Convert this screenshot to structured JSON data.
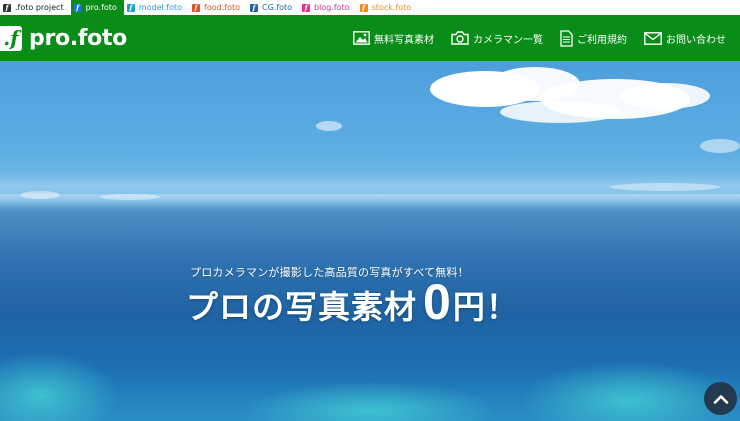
{
  "tabs": [
    {
      "label": ".foto project",
      "mark": "f",
      "color": "#222222",
      "mark_color": "#333333",
      "active": false
    },
    {
      "label": "pro.foto",
      "mark": "f",
      "color": "#ffffff",
      "mark_color": "#1d6fd1",
      "active": true
    },
    {
      "label": "model.foto",
      "mark": "f",
      "color": "#1e9ed6",
      "mark_color": "#1e9ed6",
      "active": false
    },
    {
      "label": "food.foto",
      "mark": "f",
      "color": "#e2532a",
      "mark_color": "#e2532a",
      "active": false
    },
    {
      "label": "CG.foto",
      "mark": "f",
      "color": "#2363a8",
      "mark_color": "#2363a8",
      "active": false
    },
    {
      "label": "blog.foto",
      "mark": "f",
      "color": "#e0348b",
      "mark_color": "#e0348b",
      "active": false
    },
    {
      "label": "stock.foto",
      "mark": "f",
      "color": "#f08a1c",
      "mark_color": "#f08a1c",
      "active": false
    }
  ],
  "header": {
    "logo_mark": ".f",
    "logo_text": "pro.foto",
    "nav": [
      {
        "label": "無料写真素材",
        "icon": "image-icon"
      },
      {
        "label": "カメラマン一覧",
        "icon": "camera-icon"
      },
      {
        "label": "ご利用規約",
        "icon": "document-icon"
      },
      {
        "label": "お問い合わせ",
        "icon": "mail-icon"
      }
    ]
  },
  "hero": {
    "subtitle": "プロカメラマンが撮影した高品質の写真がすべて無料！",
    "title_main": "プロの写真素材",
    "title_zero": "0",
    "title_yen": "円！"
  },
  "scroll_top": {
    "icon": "chevron-up-icon"
  },
  "colors": {
    "brand_green": "#0a8c18",
    "scroll_button": "#233a4e"
  }
}
